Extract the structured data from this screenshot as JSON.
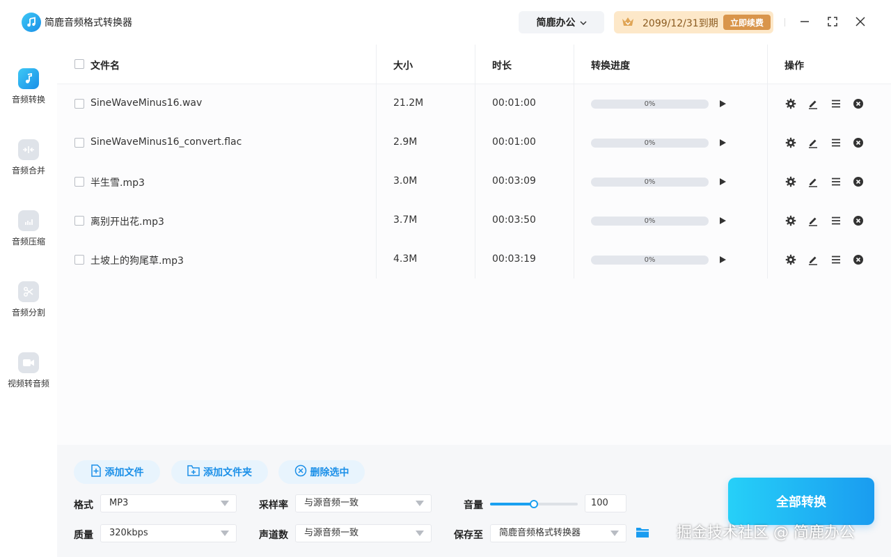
{
  "app": {
    "title": "简鹿音频格式转换器"
  },
  "titlebar": {
    "office_label": "简鹿办公",
    "vip_date": "2099/12/31到期",
    "renew_label": "立即续费"
  },
  "sidebar": {
    "items": [
      {
        "label": "音频转换",
        "icon": "music-note-icon",
        "active": true
      },
      {
        "label": "音频合并",
        "icon": "merge-icon",
        "active": false
      },
      {
        "label": "音频压缩",
        "icon": "compress-icon",
        "active": false
      },
      {
        "label": "音频分割",
        "icon": "scissors-icon",
        "active": false
      },
      {
        "label": "视频转音频",
        "icon": "video-camera-icon",
        "active": false
      }
    ]
  },
  "table": {
    "headers": {
      "name": "文件名",
      "size": "大小",
      "duration": "时长",
      "progress": "转换进度",
      "actions": "操作"
    },
    "rows": [
      {
        "name": "SineWaveMinus16.wav",
        "size": "21.2M",
        "duration": "00:01:00",
        "progress": "0%",
        "progress_value": 0
      },
      {
        "name": "SineWaveMinus16_convert.flac",
        "size": "2.9M",
        "duration": "00:01:00",
        "progress": "0%",
        "progress_value": 0
      },
      {
        "name": "半生雪.mp3",
        "size": "3.0M",
        "duration": "00:03:09",
        "progress": "0%",
        "progress_value": 0
      },
      {
        "name": "离别开出花.mp3",
        "size": "3.7M",
        "duration": "00:03:50",
        "progress": "0%",
        "progress_value": 0
      },
      {
        "name": "土坡上的狗尾草.mp3",
        "size": "4.3M",
        "duration": "00:03:19",
        "progress": "0%",
        "progress_value": 0
      }
    ]
  },
  "toolbar": {
    "add_file": "添加文件",
    "add_folder": "添加文件夹",
    "delete_selected": "删除选中"
  },
  "settings": {
    "format_label": "格式",
    "format_value": "MP3",
    "quality_label": "质量",
    "quality_value": "320kbps",
    "samplerate_label": "采样率",
    "samplerate_value": "与源音频一致",
    "channels_label": "声道数",
    "channels_value": "与源音频一致",
    "volume_label": "音量",
    "volume_value": "100",
    "volume_fraction": 0.5,
    "saveto_label": "保存至",
    "saveto_value": "简鹿音频格式转换器"
  },
  "convert_all_label": "全部转换",
  "watermark": "掘金技术社区 @ 简鹿办公",
  "colors": {
    "accent": "#1aa0f0",
    "vip_bg": "#fde8c9",
    "renew": "#d9954b"
  }
}
